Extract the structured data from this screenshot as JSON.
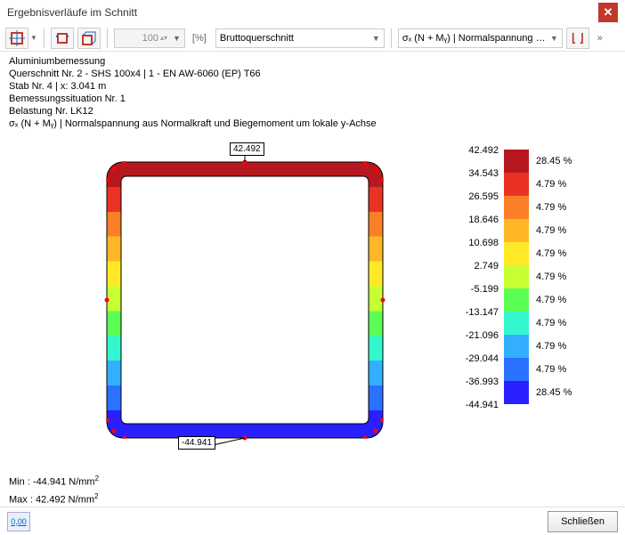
{
  "window": {
    "title": "Ergebnisverläufe im Schnitt"
  },
  "toolbar": {
    "zoom_value": "100",
    "zoom_unit": "[%]",
    "section_sel": "Bruttoquerschnitt",
    "result_sel": "σₓ (N + Mᵧ) | Normalspannung au…"
  },
  "info": {
    "l1": "Aluminiumbemessung",
    "l2": "Querschnitt Nr. 2 - SHS 100x4 | 1 - EN AW-6060 (EP) T66",
    "l3": "Stab Nr. 4 | x: 3.041 m",
    "l4": "Bemessungssituation Nr. 1",
    "l5": "Belastung Nr. LK12",
    "l6": "σₓ (N + Mᵧ) | Normalspannung aus Normalkraft und Biegemoment um lokale y-Achse"
  },
  "labels": {
    "top_value": "42.492",
    "bot_value": "-44.941"
  },
  "minmax": {
    "min_label": "Min :",
    "min_value": "-44.941 N/mm",
    "max_label": "Max :",
    "max_value": "42.492 N/mm"
  },
  "legend": {
    "ticks": [
      "42.492",
      "34.543",
      "26.595",
      "18.646",
      "10.698",
      "2.749",
      "-5.199",
      "-13.147",
      "-21.096",
      "-29.044",
      "-36.993",
      "-44.941"
    ],
    "colors": [
      "#b7181f",
      "#e93224",
      "#fb7f27",
      "#ffb728",
      "#ffe927",
      "#c7ff33",
      "#5bff54",
      "#33f7cf",
      "#33afff",
      "#2a72ff",
      "#2a1fff"
    ],
    "pcts": [
      "28.45 %",
      "4.79 %",
      "4.79 %",
      "4.79 %",
      "4.79 %",
      "4.79 %",
      "4.79 %",
      "4.79 %",
      "4.79 %",
      "4.79 %",
      "28.45 %"
    ]
  },
  "footer": {
    "num_btn": "0,00",
    "close": "Schließen"
  },
  "chart_data": {
    "type": "heatmap",
    "title": "σx (N + My) Normalspannung – SHS 100x4",
    "value_label": "σx [N/mm²]",
    "range": [
      -44.941,
      42.492
    ],
    "legend": [
      {
        "upper": 42.492,
        "lower": 34.543,
        "pct": 28.45,
        "color": "#b7181f"
      },
      {
        "upper": 34.543,
        "lower": 26.595,
        "pct": 4.79,
        "color": "#e93224"
      },
      {
        "upper": 26.595,
        "lower": 18.646,
        "pct": 4.79,
        "color": "#fb7f27"
      },
      {
        "upper": 18.646,
        "lower": 10.698,
        "pct": 4.79,
        "color": "#ffb728"
      },
      {
        "upper": 10.698,
        "lower": 2.749,
        "pct": 4.79,
        "color": "#ffe927"
      },
      {
        "upper": 2.749,
        "lower": -5.199,
        "pct": 4.79,
        "color": "#c7ff33"
      },
      {
        "upper": -5.199,
        "lower": -13.147,
        "pct": 4.79,
        "color": "#5bff54"
      },
      {
        "upper": -13.147,
        "lower": -21.096,
        "pct": 4.79,
        "color": "#33f7cf"
      },
      {
        "upper": -21.096,
        "lower": -29.044,
        "pct": 4.79,
        "color": "#33afff"
      },
      {
        "upper": -29.044,
        "lower": -36.993,
        "pct": 4.79,
        "color": "#2a72ff"
      },
      {
        "upper": -36.993,
        "lower": -44.941,
        "pct": 28.45,
        "color": "#2a1fff"
      }
    ],
    "annotations": [
      {
        "text": "42.492",
        "position": "top"
      },
      {
        "text": "-44.941",
        "position": "bottom"
      }
    ]
  }
}
